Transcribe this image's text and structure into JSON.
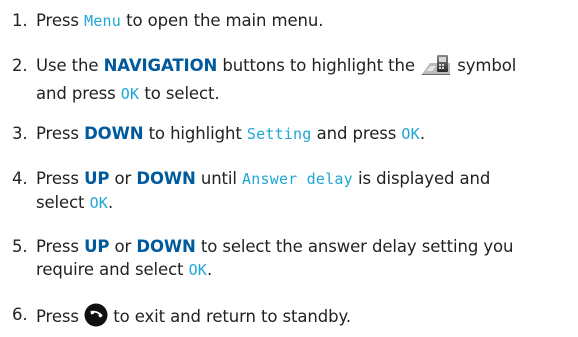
{
  "steps": [
    {
      "number": "1.",
      "parts": [
        {
          "t": "Press "
        },
        {
          "t": "Menu",
          "c": "lcd"
        },
        {
          "t": " to open the main menu."
        }
      ]
    },
    {
      "number": "2.",
      "lines": [
        [
          {
            "t": "Use the "
          },
          {
            "t": "NAVIGATION",
            "c": "kw"
          },
          {
            "t": " buttons to highlight the "
          },
          {
            "icon": "settings-menu-icon"
          },
          {
            "t": " symbol"
          }
        ],
        [
          {
            "t": "and press "
          },
          {
            "t": "OK",
            "c": "lcd"
          },
          {
            "t": " to select."
          }
        ]
      ]
    },
    {
      "number": "3.",
      "parts": [
        {
          "t": "Press "
        },
        {
          "t": "DOWN",
          "c": "kw"
        },
        {
          "t": " to highlight "
        },
        {
          "t": "Setting",
          "c": "lcd"
        },
        {
          "t": " and press "
        },
        {
          "t": "OK",
          "c": "lcd"
        },
        {
          "t": "."
        }
      ]
    },
    {
      "number": "4.",
      "lines": [
        [
          {
            "t": "Press "
          },
          {
            "t": "UP",
            "c": "kw"
          },
          {
            "t": " or "
          },
          {
            "t": "DOWN",
            "c": "kw"
          },
          {
            "t": " until "
          },
          {
            "t": "Answer delay",
            "c": "lcd"
          },
          {
            "t": " is displayed and"
          }
        ],
        [
          {
            "t": "select "
          },
          {
            "t": "OK",
            "c": "lcd"
          },
          {
            "t": "."
          }
        ]
      ]
    },
    {
      "number": "5.",
      "lines": [
        [
          {
            "t": "Press "
          },
          {
            "t": "UP",
            "c": "kw"
          },
          {
            "t": " or "
          },
          {
            "t": "DOWN",
            "c": "kw"
          },
          {
            "t": " to select the answer delay setting you"
          }
        ],
        [
          {
            "t": "require and select "
          },
          {
            "t": "OK",
            "c": "lcd"
          },
          {
            "t": "."
          }
        ]
      ]
    },
    {
      "number": "6.",
      "parts": [
        {
          "t": "Press "
        },
        {
          "icon": "end-call-icon"
        },
        {
          "t": " to exit and return to standby."
        }
      ]
    }
  ],
  "colors": {
    "text": "#222222",
    "keyword": "#005a9c",
    "lcd_text": "#1fa7d6"
  }
}
